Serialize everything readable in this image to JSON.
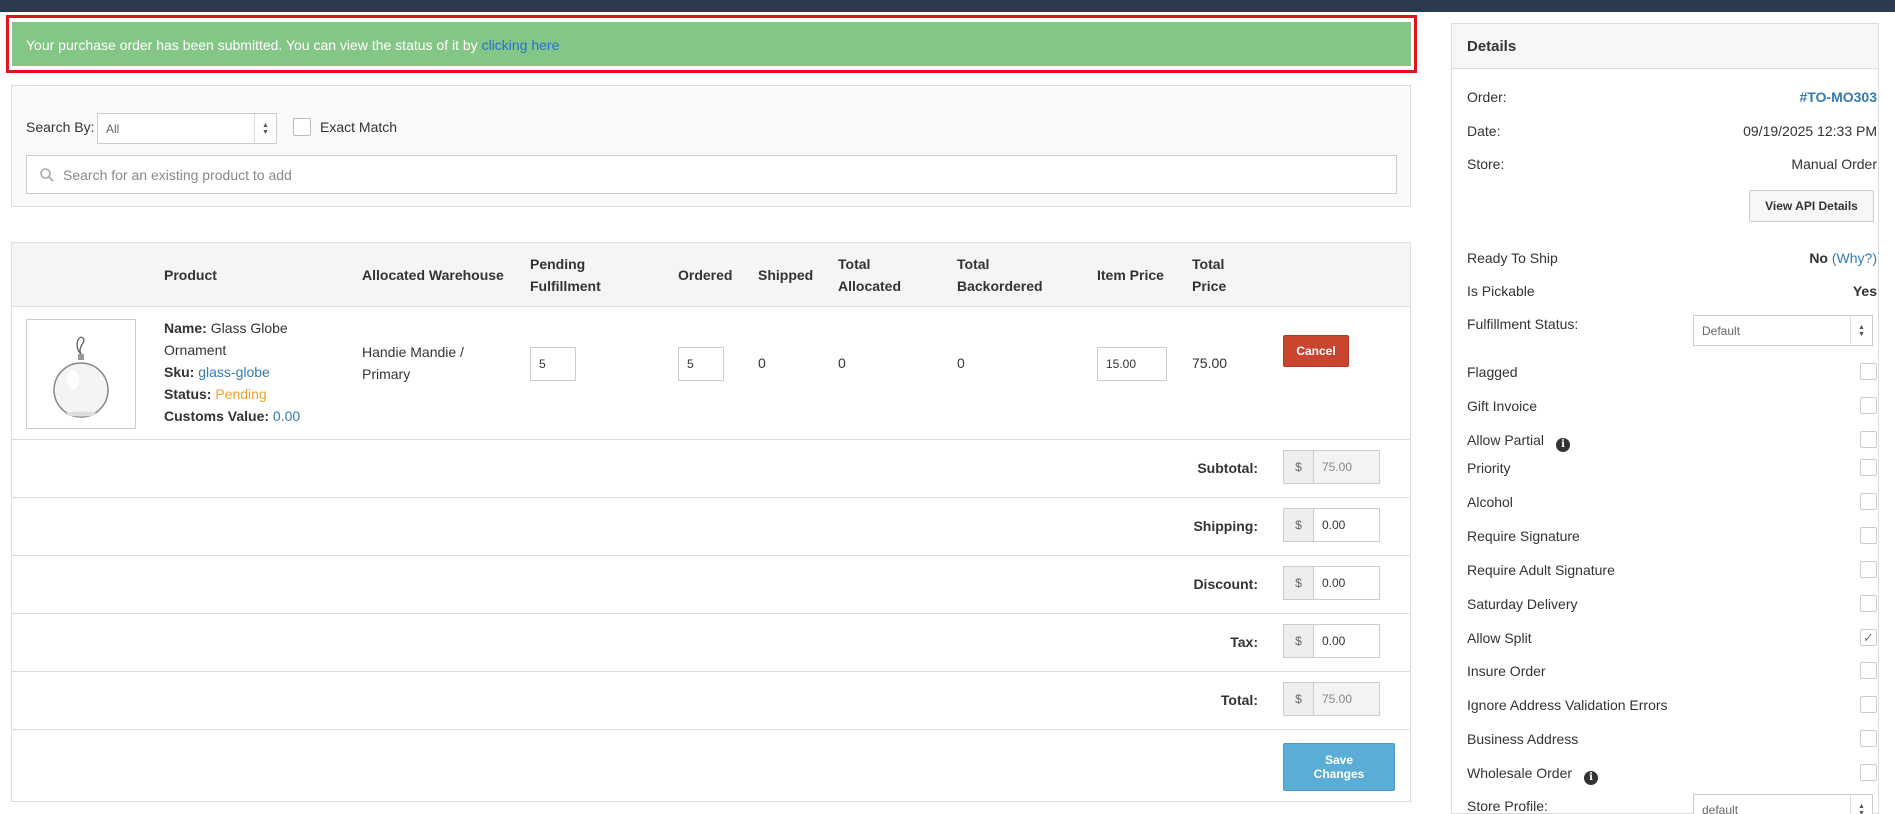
{
  "alert": {
    "message": "Your purchase order has been submitted. You can view the status of it by",
    "link": "clicking here"
  },
  "search": {
    "search_by_label": "Search By:",
    "search_by_value": "All",
    "exact_match_label": "Exact Match",
    "placeholder": "Search for an existing product to add"
  },
  "table": {
    "headers": {
      "product": "Product",
      "warehouse": "Allocated Warehouse",
      "pending_1": "Pending",
      "pending_2": "Fulfillment",
      "ordered": "Ordered",
      "shipped": "Shipped",
      "total_allocated_1": "Total",
      "total_allocated_2": "Allocated",
      "total_backordered_1": "Total",
      "total_backordered_2": "Backordered",
      "item_price": "Item Price",
      "total_price_1": "Total",
      "total_price_2": "Price"
    },
    "row": {
      "name_label": "Name:",
      "name": "Glass Globe Ornament",
      "sku_label": "Sku:",
      "sku": "glass-globe",
      "status_label": "Status:",
      "status": "Pending",
      "customs_label": "Customs Value:",
      "customs_value": "0.00",
      "warehouse": "Handie Mandie / Primary",
      "pending_fulfillment": "5",
      "ordered": "5",
      "shipped": "0",
      "total_allocated": "0",
      "total_backordered": "0",
      "item_price": "15.00",
      "total_price": "75.00",
      "cancel_label": "Cancel"
    },
    "currency": "$",
    "totals": {
      "subtotal_label": "Subtotal:",
      "subtotal": "75.00",
      "shipping_label": "Shipping:",
      "shipping": "0.00",
      "discount_label": "Discount:",
      "discount": "0.00",
      "tax_label": "Tax:",
      "tax": "0.00",
      "total_label": "Total:",
      "total": "75.00"
    },
    "save_label_1": "Save",
    "save_label_2": "Changes"
  },
  "details": {
    "title": "Details",
    "order_label": "Order:",
    "order": "#TO-MO303",
    "date_label": "Date:",
    "date": "09/19/2025 12:33 PM",
    "store_label": "Store:",
    "store": "Manual Order",
    "view_api_label": "View API Details",
    "ready_label": "Ready To Ship",
    "ready_value": "No",
    "why_label": "(Why?)",
    "pickable_label": "Is Pickable",
    "pickable_value": "Yes",
    "fulfillment_label": "Fulfillment Status:",
    "fulfillment_value": "Default",
    "flags": [
      {
        "label": "Flagged",
        "checked": false
      },
      {
        "label": "Gift Invoice",
        "checked": false
      },
      {
        "label": "Allow Partial",
        "checked": false
      },
      {
        "label": "Priority",
        "checked": false
      },
      {
        "label": "Alcohol",
        "checked": false
      },
      {
        "label": "Require Signature",
        "checked": false
      },
      {
        "label": "Require Adult Signature",
        "checked": false
      },
      {
        "label": "Saturday Delivery",
        "checked": false
      },
      {
        "label": "Allow Split",
        "checked": true
      },
      {
        "label": "Insure Order",
        "checked": false
      },
      {
        "label": "Ignore Address Validation Errors",
        "checked": false
      },
      {
        "label": "Business Address",
        "checked": false
      },
      {
        "label": "Wholesale Order",
        "checked": false
      }
    ],
    "store_profile_label": "Store Profile:",
    "store_profile_value": "default"
  }
}
